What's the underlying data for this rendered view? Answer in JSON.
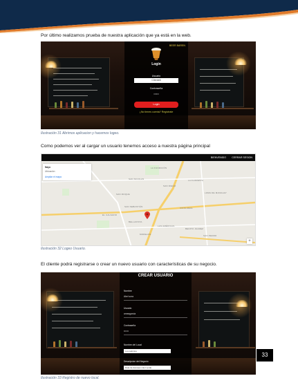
{
  "paragraphs": {
    "p1": "Por último realizamos prueba de nuestra aplicación que ya está en la web.",
    "p2": "Como podemos ver al cargar un usuario tenemos acceso a nuestra página principal",
    "p3": "El cliente podrá registrarse o crear un nuevo usuario con características de su negocio."
  },
  "captions": {
    "c31": "Ilustración 31 Abrimos aplicacion y hacemos logeo.",
    "c32": "Ilustración 32 Logeo Usuario.",
    "c33": "Ilustración 33 Registro de nuevo local."
  },
  "login": {
    "brand": "BEER BAREN",
    "title": "Login",
    "user_label": "Usuario",
    "user_value": "Cliente6",
    "pass_label": "Contraseña",
    "pass_value": "••••••",
    "button": "Login",
    "register_link": "¿No tienes cuenta? Regístrate"
  },
  "map": {
    "nav_right": [
      "BIENVENIDO",
      "CERRAR SESION"
    ],
    "info_title": "Nayo",
    "info_sub": "Ubicación",
    "info_link": "Ampliar el mapa",
    "labels": {
      "la_fundicion": "LA FUNDICIÓN",
      "san_nicolas": "SAN NICOLAS",
      "san_diego": "SAN DIEGO",
      "la_floresta": "LA FLORESTA",
      "loma_manchay": "LOMA DE MANCHAY",
      "san_roque": "SAN ROQUE",
      "san_sebastian": "SAN SEBASTIÁN",
      "el_calvario": "EL CALVARIO",
      "bellavista": "BELLAVISTA",
      "las_americas": "LAS AMÉRICAS",
      "benito_juarez": "BENITO JUAREZ",
      "vista_real": "VISTA REAL",
      "san_pedro": "SAN PEDRO",
      "morelos": "MORELOS"
    }
  },
  "register": {
    "title": "CREAR USUARIO",
    "fields": [
      {
        "label": "Nombre",
        "value": "Abel sora",
        "style": "line"
      },
      {
        "label": "Usuario",
        "value": "ameagarcia",
        "style": "line"
      },
      {
        "label": "Contraseña",
        "value": "••••••",
        "style": "line"
      },
      {
        "label": "Nombre del Local",
        "value": "Los palmitos",
        "style": "box"
      },
      {
        "label": "Descripcion del Negocio",
        "value": "Data de docuses color verde",
        "style": "box"
      }
    ]
  },
  "page_number": "33",
  "colors": {
    "header_navy": "#0f2a4a",
    "header_orange": "#e07a2a",
    "caption_blue": "#5b6f8a",
    "login_red": "#e01e1e",
    "marker_red": "#d93025"
  }
}
